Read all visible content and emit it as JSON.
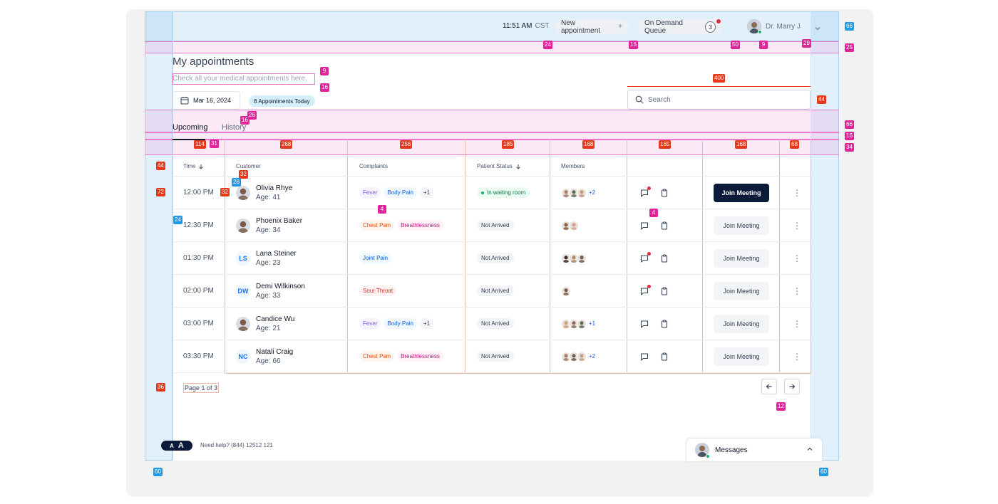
{
  "colors": {
    "accent_navy": "#0b1a3a",
    "overlay_blue": "#a7d3f2",
    "overlay_pink": "#ee79c9",
    "spec_red": "#e8381a",
    "spec_pink": "#e0259b",
    "spec_blue": "#1e9ae6"
  },
  "header": {
    "time": "11:51 AM",
    "timezone": "CST",
    "new_appointment_label": "New appointment",
    "new_appointment_icon": "+",
    "queue_label": "On Demand Queue",
    "queue_count": "3",
    "doctor_name": "Dr. Marry J"
  },
  "page": {
    "title": "My appointments",
    "subtitle": "Check all your medical appointments here.",
    "date": "Mar 16, 2024",
    "today_badge": "8 Appointments Today",
    "search_placeholder": "Search"
  },
  "tabs": [
    {
      "label": "Upcoming",
      "active": true
    },
    {
      "label": "History",
      "active": false
    }
  ],
  "table": {
    "columns": {
      "time": "Time",
      "customer": "Customer",
      "complaints": "Complaints",
      "status": "Patient Status",
      "members": "Members"
    },
    "rows": [
      {
        "time": "12:00 PM",
        "name": "Olivia Rhye",
        "age": "Age: 41",
        "avatar": "photo",
        "complaints": [
          {
            "label": "Fever",
            "type": "fever"
          },
          {
            "label": "Body Pain",
            "type": "body"
          },
          {
            "label": "+1",
            "type": "more"
          }
        ],
        "status": "In waiting room",
        "status_type": "wait",
        "members": [
          "#a47b6a",
          "#5b6b5a",
          "#c29a7a"
        ],
        "members_more": "+2",
        "message_unread": true,
        "join_label": "Join Meeting",
        "join_primary": true
      },
      {
        "time": "12:30 PM",
        "name": "Phoenix Baker",
        "age": "Age: 34",
        "avatar": "photo",
        "complaints": [
          {
            "label": "Chest Pain",
            "type": "chest"
          },
          {
            "label": "Breathlessness",
            "type": "breath"
          }
        ],
        "status": "Not Arrived",
        "status_type": "not",
        "members": [
          "#8a5a3c",
          "#d7a38b"
        ],
        "members_more": "",
        "message_unread": false,
        "join_label": "Join Meeting",
        "join_primary": false
      },
      {
        "time": "01:30 PM",
        "name": "Lana Steiner",
        "age": "Age: 23",
        "avatar": "LS",
        "complaints": [
          {
            "label": "Joint Pain",
            "type": "joint"
          }
        ],
        "status": "Not Arrived",
        "status_type": "not",
        "members": [
          "#3a2b25",
          "#a48767",
          "#6b5a4f"
        ],
        "members_more": "",
        "message_unread": true,
        "join_label": "Join Meeting",
        "join_primary": false
      },
      {
        "time": "02:00 PM",
        "name": "Demi Wilkinson",
        "age": "Age: 33",
        "avatar": "DW",
        "complaints": [
          {
            "label": "Sour Throat",
            "type": "sour"
          }
        ],
        "status": "Not Arrived",
        "status_type": "not",
        "members": [
          "#7a5a4a"
        ],
        "members_more": "",
        "message_unread": true,
        "join_label": "Join Meeting",
        "join_primary": false
      },
      {
        "time": "03:00 PM",
        "name": "Candice Wu",
        "age": "Age: 21",
        "avatar": "photo",
        "complaints": [
          {
            "label": "Fever",
            "type": "fever"
          },
          {
            "label": "Body Pain",
            "type": "body"
          },
          {
            "label": "+1",
            "type": "more"
          }
        ],
        "status": "Not Arrived",
        "status_type": "not",
        "members": [
          "#c9a07e",
          "#8a6a52",
          "#5e6a5a"
        ],
        "members_more": "+1",
        "message_unread": false,
        "join_label": "Join Meeting",
        "join_primary": false
      },
      {
        "time": "03:30 PM",
        "name": "Natali Craig",
        "age": "Age: 66",
        "avatar": "NC",
        "complaints": [
          {
            "label": "Chest Pain",
            "type": "chest"
          },
          {
            "label": "Breathlessness",
            "type": "breath"
          }
        ],
        "status": "Not Arrived",
        "status_type": "not",
        "members": [
          "#a47b6a",
          "#6b5a4f",
          "#c9a07e"
        ],
        "members_more": "+2",
        "message_unread": false,
        "join_label": "Join Meeting",
        "join_primary": false
      }
    ]
  },
  "pagination": {
    "label": "Page 1 of 3"
  },
  "footer": {
    "font_small": "A",
    "font_large": "A",
    "help_text": "Need help?  (844) 12512 121",
    "messages_label": "Messages"
  },
  "spec_labels": {
    "right_66a": "66",
    "right_25": "25",
    "right_44": "44",
    "right_66b": "66",
    "right_16": "16",
    "right_34": "34",
    "hdr_24": "24",
    "hdr_16": "16",
    "hdr_50": "50",
    "hdr_9": "9",
    "hdr_29": "29",
    "title_9": "9",
    "title_16": "16",
    "search_400": "400",
    "date_16": "16",
    "date_26": "26",
    "col_114": "114",
    "col_31": "31",
    "col_268": "268",
    "col_256": "256",
    "col_185": "185",
    "col_168a": "168",
    "col_165": "165",
    "col_168b": "168",
    "col_68": "68",
    "left_44": "44",
    "left_72": "72",
    "left_36": "36",
    "cell_32a": "32",
    "cell_32b": "32",
    "cell_26": "26",
    "cell_24": "24",
    "chip_4": "4",
    "act_4": "4",
    "pg_12": "12",
    "bottom_60a": "60",
    "bottom_60b": "60"
  }
}
